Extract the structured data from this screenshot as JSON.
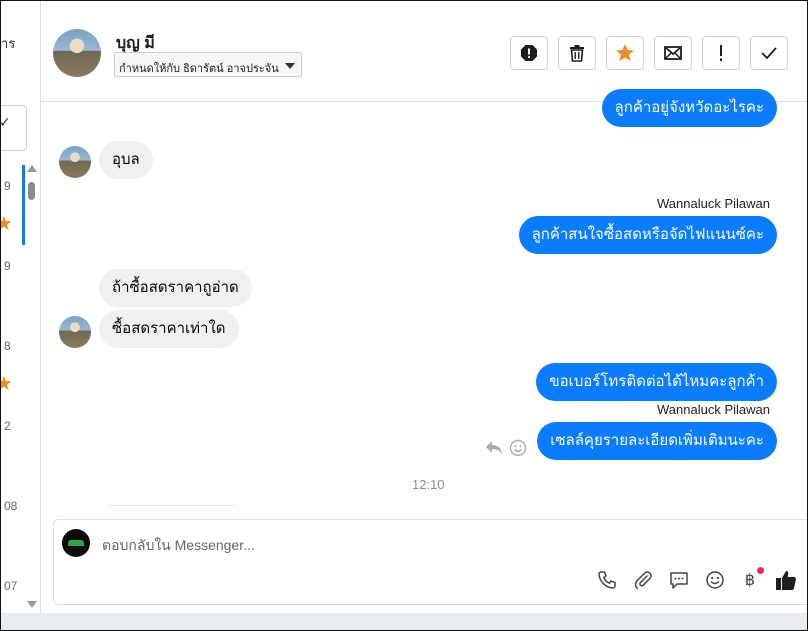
{
  "sidebar": {
    "cut_label": "าร",
    "box_glyph": "✓",
    "items": [
      {
        "num": "9",
        "starred": true
      },
      {
        "num": "9",
        "starred": false
      },
      {
        "num": "8",
        "starred": true
      },
      {
        "num": "2",
        "starred": false
      },
      {
        "num": "08",
        "starred": false
      },
      {
        "num": "07",
        "starred": false
      }
    ]
  },
  "header": {
    "contact_name": "บุญ มี",
    "assigned_to": "กำหนดให้กับ ธิดารัตน์ อาจประจัน",
    "toolbar": {
      "spam": "spam-icon",
      "delete": "trash-icon",
      "star": "star-icon",
      "mark_unread": "envelope-icon",
      "flag": "exclamation-icon",
      "done": "check-icon"
    }
  },
  "conversation": {
    "messages": [
      {
        "direction": "out",
        "text": "ลูกค้าอยู่จังหวัดอะไรคะ"
      },
      {
        "direction": "in",
        "text": "อุบล"
      },
      {
        "direction": "out",
        "sender": "Wannaluck Pilawan",
        "text": "ลูกค้าสนใจซื้อสดหรือจัดไฟแนนซ์คะ"
      },
      {
        "direction": "in",
        "text": "ถ้าซื้อสดราคาถูอ่าด"
      },
      {
        "direction": "in",
        "text": "ซื้อสดราคาเท่าใด"
      },
      {
        "direction": "out",
        "text": "ขอเบอร์โทรติดต่อได้ไหมคะลูกค้า"
      },
      {
        "direction": "out",
        "sender": "Wannaluck Pilawan",
        "text": "เซลล์คุยรายละเอียดเพิ่มเติมนะคะ"
      }
    ],
    "timestamp": "12:10"
  },
  "composer": {
    "placeholder": "ตอบกลับใน Messenger...",
    "icons": [
      "phone-icon",
      "paperclip-icon",
      "chat-bubble-icon",
      "emoji-icon",
      "baht-icon",
      "thumbs-up-icon"
    ],
    "baht_symbol": "฿"
  },
  "colors": {
    "outgoing_bubble": "#0a7cff",
    "incoming_bubble": "#f0f0f0",
    "star": "#f08a24",
    "accent": "#1877f2"
  }
}
